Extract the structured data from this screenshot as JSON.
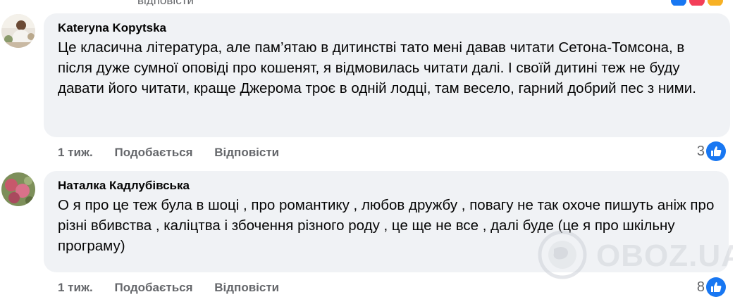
{
  "top_strip": {
    "partial_text": "відповісти"
  },
  "comments": [
    {
      "author": "Kateryna Kopytska",
      "text": "Це класична література, але пам’ятаю в дитинстві тато мені давав читати Сетона-Томсона, в після дуже сумної оповіді про кошенят, я відмовилась читати далі. І своїй дитині теж не буду давати його читати, краще Джерома троє в одній лодці, там весело, гарний добрий пес з ними.",
      "time": "1 тиж.",
      "like_label": "Подобається",
      "reply_label": "Відповісти",
      "reaction_count": "3"
    },
    {
      "author": "Наталка Кадлубівська",
      "text": "О я про це теж була в шоці , про романтику , любов дружбу , повагу не так охоче пишуть аніж про різні вбивства , каліцтва і збочення різного роду , це ще не все , далі буде (це я про шкільну програму)",
      "time": "1 тиж.",
      "like_label": "Подобається",
      "reply_label": "Відповісти",
      "reaction_count": "8"
    }
  ],
  "watermark": {
    "text": "OBOZ.UA"
  },
  "colors": {
    "bubble": "#f0f2f5",
    "meta": "#65676b",
    "like": "#1877f2"
  }
}
